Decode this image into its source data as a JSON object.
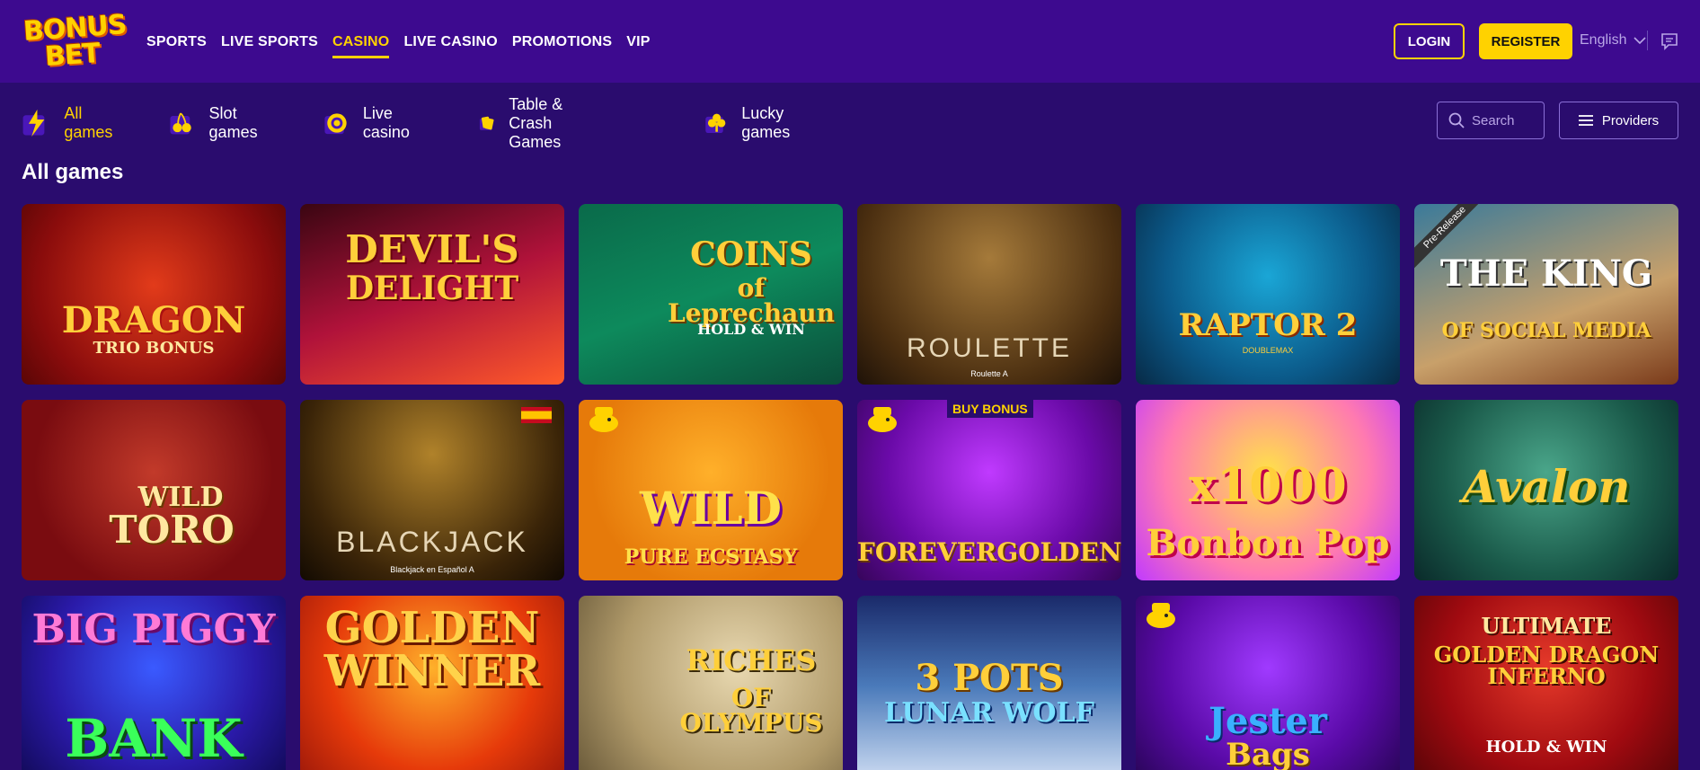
{
  "brand": {
    "logo_line1": "BONUS",
    "logo_line2": "BET"
  },
  "nav": {
    "items": [
      "SPORTS",
      "LIVE SPORTS",
      "CASINO",
      "LIVE CASINO",
      "PROMOTIONS",
      "VIP"
    ],
    "active": "CASINO"
  },
  "auth": {
    "login": "LOGIN",
    "register": "REGISTER"
  },
  "language": "English",
  "categories": [
    "All games",
    "Slot games",
    "Live casino",
    "Table & Crash Games",
    "Lucky games"
  ],
  "search": {
    "placeholder": "Search"
  },
  "providers_label": "Providers",
  "section_title": "All games",
  "games": [
    {
      "title": "DRAGON",
      "subtitle": "TRIO BONUS"
    },
    {
      "title": "DEVIL'S",
      "subtitle": "DELIGHT"
    },
    {
      "title": "COINS",
      "subtitle": "of Leprechaun",
      "extra": "HOLD & WIN"
    },
    {
      "title": "ROULETTE",
      "caption": "Roulette A"
    },
    {
      "title": "RAPTOR 2",
      "subtitle": "DOUBLEMAX"
    },
    {
      "title": "THE KING",
      "subtitle": "OF SOCIAL MEDIA",
      "badge": "Pre-Release"
    },
    {
      "title": "WILD",
      "subtitle": "TORO"
    },
    {
      "title": "BLACKJACK",
      "caption": "Blackjack en Español A"
    },
    {
      "title": "WILD",
      "subtitle": "PURE ECSTASY"
    },
    {
      "title": "FOREVERGOLDEN",
      "badge": "BUY BONUS"
    },
    {
      "title": "x1000",
      "subtitle": "Bonbon Pop"
    },
    {
      "title": "Avalon"
    },
    {
      "title": "BIG PIGGY",
      "subtitle": "BANK"
    },
    {
      "title": "GOLDEN",
      "subtitle": "WINNER"
    },
    {
      "title": "RICHES",
      "subtitle": "OF OLYMPUS"
    },
    {
      "title": "3 POTS",
      "subtitle": "LUNAR WOLF"
    },
    {
      "title": "Jester",
      "subtitle": "Bags"
    },
    {
      "title": "ULTIMATE",
      "subtitle": "GOLDEN DRAGON INFERNO",
      "extra": "HOLD & WIN"
    }
  ],
  "colors": {
    "accent": "#ffd200",
    "header_bg": "#3d0a8f",
    "page_bg": "#2a0c6e"
  }
}
